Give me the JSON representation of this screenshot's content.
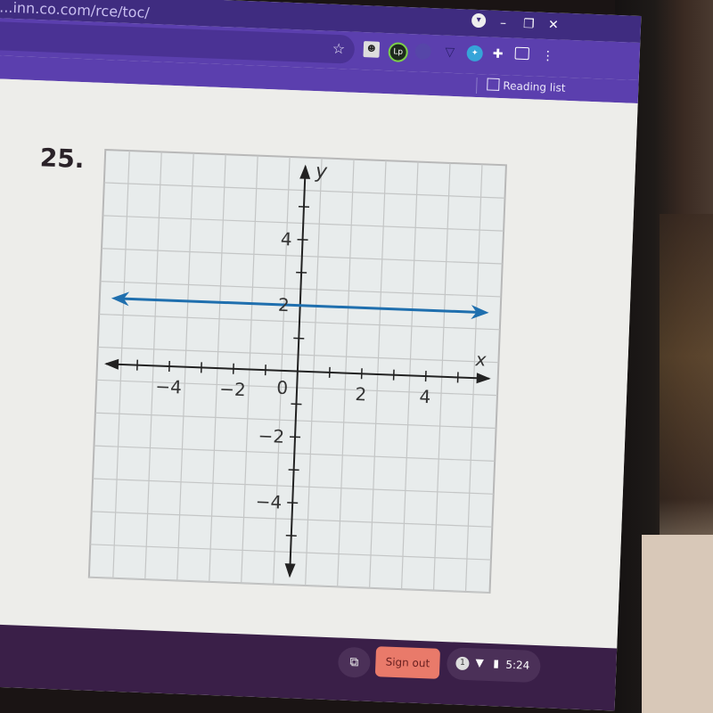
{
  "browser": {
    "url_fragment": "...inn.co.com/rce/toc/",
    "reading_list_label": "Reading list",
    "extensions": [
      "profile-extension",
      "lp-extension",
      "shield-extension",
      "vee-extension",
      "globe-extension",
      "puzzle-extension",
      "cast-icon",
      "menu-icon"
    ],
    "window_controls": {
      "minimize": "–",
      "restore": "❐",
      "close": "✕"
    }
  },
  "problem": {
    "number_label": "25."
  },
  "chart_data": {
    "type": "line",
    "title": "",
    "xlabel": "x",
    "ylabel": "y",
    "xlim": [
      -6,
      6
    ],
    "ylim": [
      -6,
      6
    ],
    "grid": true,
    "x_ticks": [
      -5,
      -4,
      -3,
      -2,
      -1,
      1,
      2,
      3,
      4,
      5
    ],
    "y_ticks": [
      -5,
      -4,
      -3,
      -2,
      -1,
      1,
      2,
      3,
      4,
      5
    ],
    "x_tick_labels": [
      {
        "value": -4,
        "label": "−4"
      },
      {
        "value": -2,
        "label": "−2"
      },
      {
        "value": 2,
        "label": "2"
      },
      {
        "value": 4,
        "label": "4"
      }
    ],
    "y_tick_labels": [
      {
        "value": 4,
        "label": "4"
      },
      {
        "value": 2,
        "label": "2"
      },
      {
        "value": -2,
        "label": "−2"
      },
      {
        "value": -4,
        "label": "−4"
      }
    ],
    "origin_label": "0",
    "series": [
      {
        "name": "y = 2",
        "color": "#1f6fae",
        "x": [
          -6,
          6
        ],
        "y": [
          2,
          2
        ],
        "arrows": "both"
      }
    ]
  },
  "shelf": {
    "sign_out_label": "Sign out",
    "notification_count": "1",
    "time": "5:24"
  }
}
